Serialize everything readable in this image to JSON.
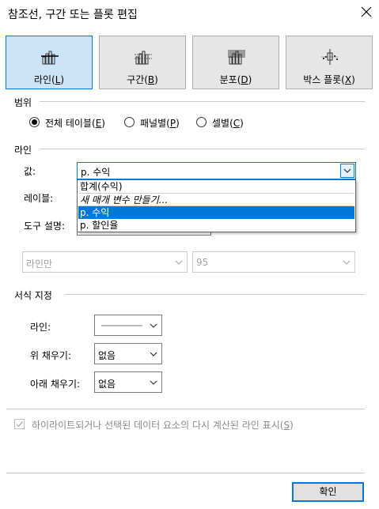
{
  "title": "참조선, 구간 또는 플롯 편집",
  "tabs": [
    {
      "label_pre": "라인(",
      "key": "L",
      "label_post": ")",
      "icon": "line-chart-icon",
      "active": true
    },
    {
      "label_pre": "구간(",
      "key": "B",
      "label_post": ")",
      "icon": "band-chart-icon",
      "active": false
    },
    {
      "label_pre": "분포(",
      "key": "D",
      "label_post": ")",
      "icon": "distribution-chart-icon",
      "active": false
    },
    {
      "label_pre": "박스 플롯(",
      "key": "X",
      "label_post": ")",
      "icon": "box-plot-icon",
      "active": false
    }
  ],
  "scope": {
    "section": "범위",
    "options": [
      {
        "pre": "전체 테이블(",
        "key": "E",
        "post": ")",
        "selected": true
      },
      {
        "pre": "패널별(",
        "key": "P",
        "post": ")",
        "selected": false
      },
      {
        "pre": "셀별(",
        "key": "C",
        "post": ")",
        "selected": false
      }
    ]
  },
  "line": {
    "section": "라인",
    "value_label": "값:",
    "value_selected": "p. 수익",
    "dropdown_items": [
      "합계(수익)",
      "새 매개 변수 만들기...",
      "p. 수익",
      "p. 할인율"
    ],
    "dropdown_selected_index": 2,
    "label_label": "레이블:",
    "tooltip_label": "도구 설명:",
    "mode_value": "라인만",
    "confidence_value": "95"
  },
  "format": {
    "section": "서식 지정",
    "line_label": "라인:",
    "fill_above_label": "위 채우기:",
    "fill_above_value": "없음",
    "fill_below_label": "아래 채우기:",
    "fill_below_value": "없음"
  },
  "recalc": {
    "pre": "하이라이트되거나 선택된 데이터 요소의 다시 계산된 라인 표시(",
    "key": "S",
    "post": ")",
    "checked": true
  },
  "ok_button": "확인",
  "colors": {
    "accent": "#0078d7",
    "tile_active_bg": "#cce4f7",
    "tile_bg": "#e6e6e6"
  }
}
